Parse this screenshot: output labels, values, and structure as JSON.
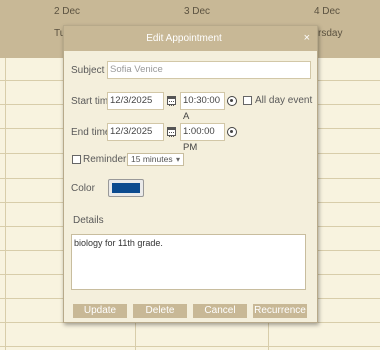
{
  "calendar": {
    "dates": [
      "2 Dec",
      "3 Dec",
      "4 Dec"
    ],
    "day_names": [
      "Tue",
      "rsday"
    ]
  },
  "dialog": {
    "title": "Edit Appointment",
    "close_icon": "×",
    "subject_label": "Subject",
    "subject_value": "Sofia Venice",
    "start_label": "Start time",
    "start_date": "12/3/2025",
    "start_time": "10:30:00 A",
    "all_day_label": "All day event",
    "end_label": "End time",
    "end_date": "12/3/2025",
    "end_time": "1:00:00 PM",
    "reminder_label": "Reminder",
    "reminder_value": "15 minutes",
    "color_label": "Color",
    "color_value": "#0b4a8f",
    "details_label": "Details",
    "details_value": "biology for 11th grade.",
    "buttons": {
      "update": "Update",
      "delete": "Delete",
      "cancel": "Cancel",
      "recurrence": "Recurrence"
    }
  },
  "icons": {
    "calendar": "calendar-icon",
    "clock": "clock-icon",
    "chevron": "▾"
  }
}
